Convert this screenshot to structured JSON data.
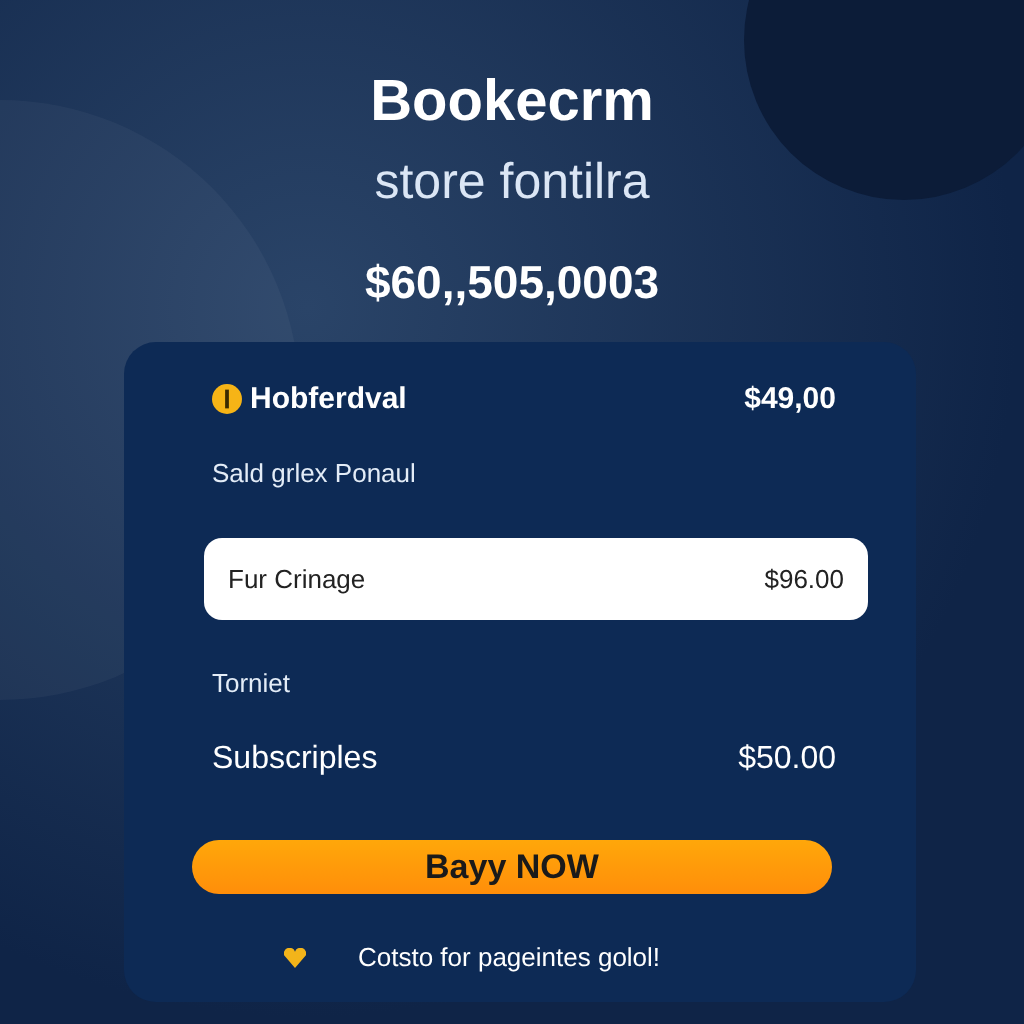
{
  "header": {
    "title": "Bookecrm",
    "subtitle": "store fontilra",
    "total": "$60,,505,0003"
  },
  "card": {
    "rows": [
      {
        "kind": "item",
        "name": "Hobferdval",
        "price": "$49,00"
      },
      {
        "kind": "note",
        "name": "Sald grlex Ponaul"
      },
      {
        "kind": "option",
        "name": "Fur Crinage",
        "price": "$96.00",
        "selected": true
      },
      {
        "kind": "note",
        "name": "Torniet"
      },
      {
        "kind": "line",
        "name": "Subscriples",
        "price": "$50.00"
      }
    ],
    "button": "Bayy NOW",
    "footer": "Cotsto for pageintes golol!"
  }
}
